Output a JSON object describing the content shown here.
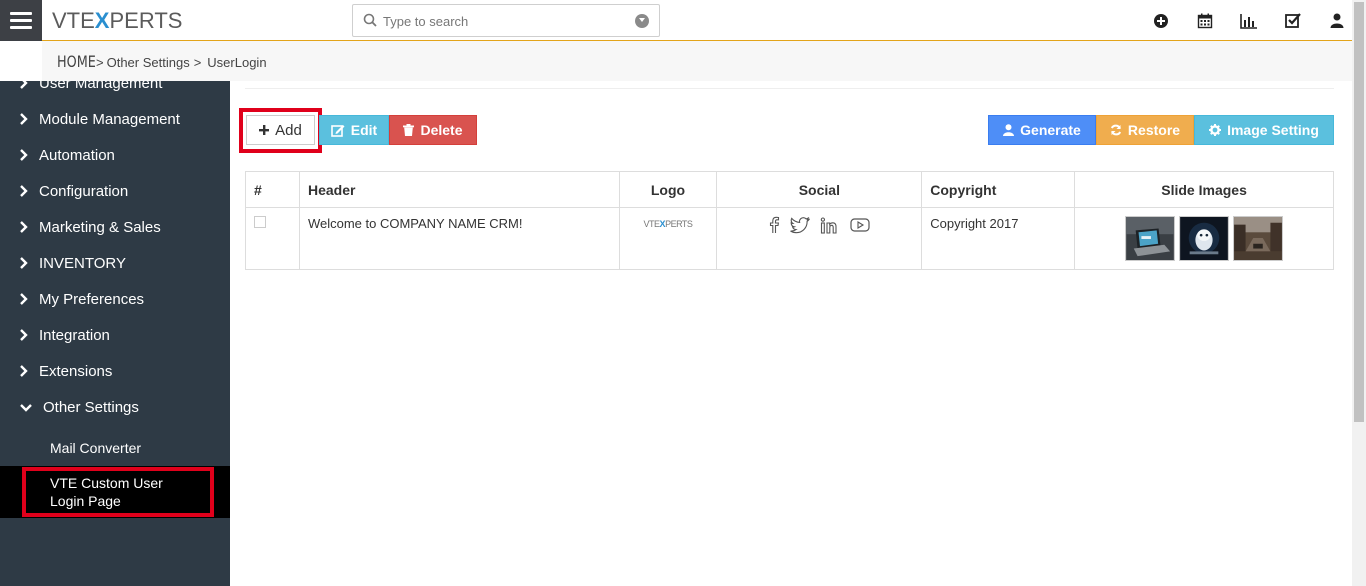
{
  "brand": {
    "prefix": "VTE",
    "x": "X",
    "suffix": "PERTS"
  },
  "search": {
    "placeholder": "Type to search"
  },
  "header_icons": [
    "plus-circle-icon",
    "calendar-icon",
    "bar-chart-icon",
    "checkbox-icon",
    "user-icon"
  ],
  "breadcrumb": {
    "home": "HOME",
    "sep": ">",
    "items": [
      "Other Settings",
      "UserLogin"
    ]
  },
  "sidebar": {
    "items": [
      {
        "label": "User Management"
      },
      {
        "label": "Module Management"
      },
      {
        "label": "Automation"
      },
      {
        "label": "Configuration"
      },
      {
        "label": "Marketing & Sales"
      },
      {
        "label": "INVENTORY"
      },
      {
        "label": "My Preferences"
      },
      {
        "label": "Integration"
      },
      {
        "label": "Extensions"
      },
      {
        "label": "Other Settings"
      }
    ],
    "sub_items": [
      {
        "label": "Mail Converter"
      },
      {
        "label": "VTE Custom User Login Page"
      }
    ]
  },
  "toolbar": {
    "add": "Add",
    "edit": "Edit",
    "delete": "Delete",
    "generate": "Generate",
    "restore": "Restore",
    "image_setting": "Image Setting"
  },
  "table": {
    "headers": [
      "#",
      "Header",
      "Logo",
      "Social",
      "Copyright",
      "Slide Images"
    ],
    "rows": [
      {
        "header": "Welcome to COMPANY NAME CRM!",
        "logo": {
          "prefix": "VTE",
          "x": "X",
          "suffix": "PERTS"
        },
        "social": [
          "facebook-icon",
          "twitter-icon",
          "linkedin-icon",
          "youtube-icon"
        ],
        "copyright": "Copyright 2017",
        "slide_images": [
          "laptop-image",
          "robot-image",
          "street-image"
        ]
      }
    ]
  },
  "colors": {
    "accent": "#e3a41a",
    "sidebar_bg": "#2e3a45",
    "highlight_box": "#e0001b",
    "edit": "#5bc0de",
    "delete": "#d9534f",
    "generate": "#4e8ef7",
    "restore": "#f0ad4e"
  }
}
